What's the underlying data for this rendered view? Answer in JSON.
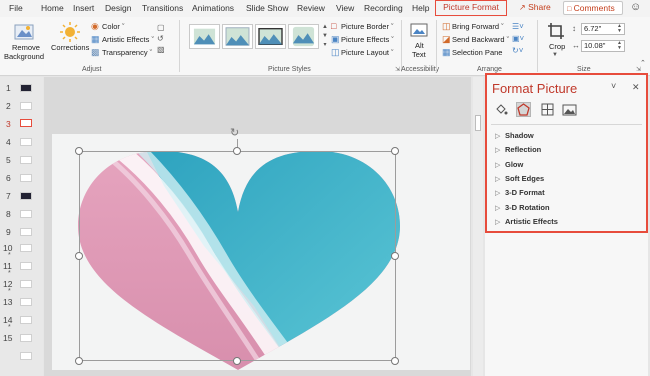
{
  "menu": {
    "items": [
      "File",
      "Home",
      "Insert",
      "Design",
      "Transitions",
      "Animations",
      "Slide Show",
      "Review",
      "View",
      "Recording",
      "Help"
    ],
    "active_tab": "Picture Format",
    "share": "Share",
    "comments": "Comments",
    "smiley": "☺"
  },
  "ribbon": {
    "remove_bg_1": "Remove",
    "remove_bg_2": "Background",
    "corrections": "Corrections",
    "color": "Color ˇ",
    "artistic_effects": "Artistic Effects ˇ",
    "transparency": "Transparency ˇ",
    "adjust_group": "Adjust",
    "picture_border": "Picture Border ˇ",
    "picture_effects": "Picture Effects ˇ",
    "picture_layout": "Picture Layout ˇ",
    "picture_styles_group": "Picture Styles",
    "alt_text_1": "Alt",
    "alt_text_2": "Text",
    "accessibility_group": "Accessibility",
    "bring_forward": "Bring Forward ˇ",
    "send_backward": "Send Backward ˇ",
    "selection_pane": "Selection Pane",
    "arrange_group": "Arrange",
    "crop": "Crop",
    "height": "6.72\"",
    "width": "10.08\"",
    "size_group": "Size"
  },
  "thumbnails": {
    "numbers": [
      "1",
      "2",
      "3",
      "4",
      "5",
      "6",
      "7",
      "8",
      "9",
      "10",
      "11",
      "12",
      "13",
      "14",
      "15"
    ],
    "selected": "3",
    "star": "*"
  },
  "format_pane": {
    "title": "Format Picture",
    "dropdown": "˅",
    "close": "✕",
    "sections": [
      "Shadow",
      "Reflection",
      "Glow",
      "Soft Edges",
      "3-D Format",
      "3-D Rotation",
      "Artistic Effects"
    ],
    "caret": "▷"
  },
  "colors": {
    "accent": "#c43e1c",
    "highlight_box": "#e74c3c",
    "water": "#3fb0c9",
    "sand": "#e2a0b9"
  }
}
